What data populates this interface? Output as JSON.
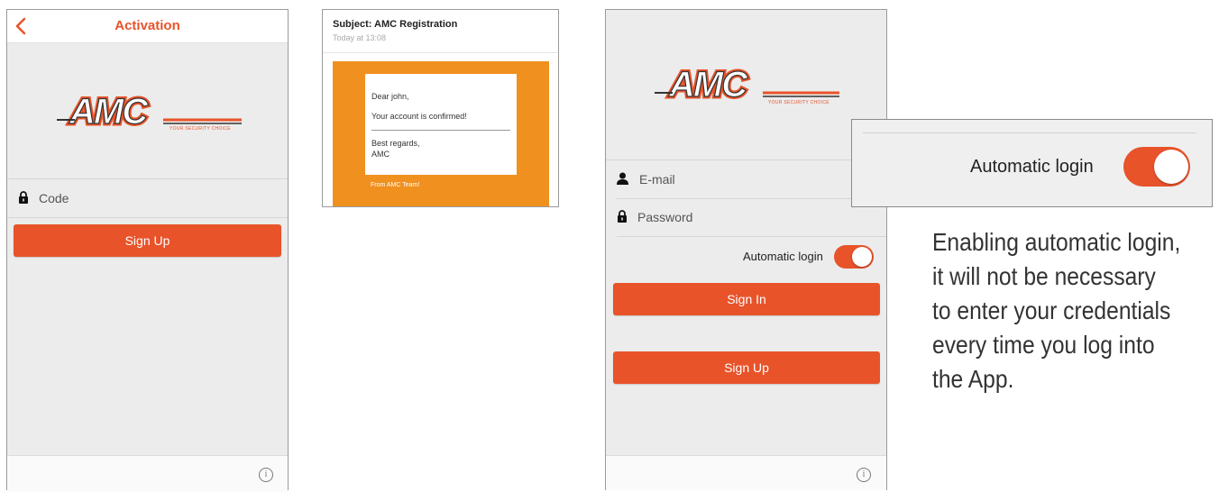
{
  "activation_screen": {
    "title": "Activation",
    "logo": {
      "text": "AMC",
      "tagline": "YOUR SECURITY CHOICE"
    },
    "code_field": {
      "label": "Code",
      "icon": "lock-icon"
    },
    "signup_button": "Sign Up",
    "info_icon": "i"
  },
  "email": {
    "subject": "Subject: AMC Registration",
    "date": "Today at 13:08",
    "greeting": "Dear john,",
    "message": "Your account is confirmed!",
    "closing": "Best regards,",
    "signature": "AMC",
    "from": "From AMC Team!"
  },
  "login_screen": {
    "logo": {
      "text": "AMC",
      "tagline": "YOUR SECURITY CHOICE"
    },
    "email_field": {
      "label": "E-mail",
      "icon": "user-icon"
    },
    "password_field": {
      "label": "Password",
      "icon": "lock-icon"
    },
    "automatic_login": {
      "label": "Automatic login",
      "enabled": true
    },
    "signin_button": "Sign In",
    "signup_button": "Sign Up",
    "info_icon": "i"
  },
  "callout": {
    "label": "Automatic login",
    "enabled": true
  },
  "description": [
    "Enabling automatic login,",
    "it will not be necessary",
    "to enter your credentials",
    "every time you log into",
    "the App."
  ],
  "colors": {
    "accent": "#e8532a",
    "email_background": "#f0901f",
    "screen_background": "#ececec"
  }
}
